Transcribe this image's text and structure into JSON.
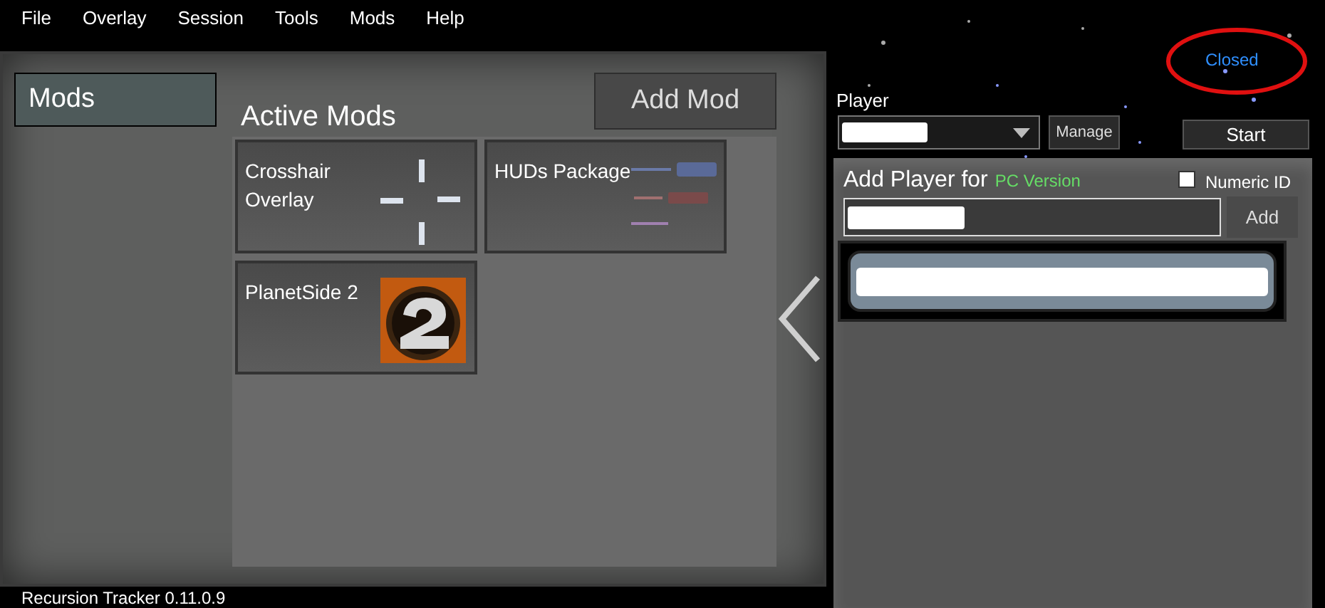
{
  "menu": [
    "File",
    "Overlay",
    "Session",
    "Tools",
    "Mods",
    "Help"
  ],
  "mods_panel": {
    "tab": {
      "label": "Mods",
      "selected": true
    },
    "title": "Active Mods",
    "add_button": "Add Mod",
    "mods": [
      {
        "name": "Crosshair Overlay",
        "kind": "crosshair"
      },
      {
        "name": "HUDs Package",
        "kind": "hud"
      },
      {
        "name": "PlanetSide 2",
        "kind": "logo"
      }
    ]
  },
  "status": {
    "label": "Closed",
    "circled": true
  },
  "player": {
    "label": "Player",
    "manage_button": "Manage",
    "start_button": "Start"
  },
  "add_player": {
    "title": "Add Player for",
    "version": "PC Version",
    "numeric_id": {
      "label": "Numeric ID",
      "checked": false
    },
    "add_button": "Add"
  },
  "status_bar": "Recursion Tracker 0.11.0.9"
}
